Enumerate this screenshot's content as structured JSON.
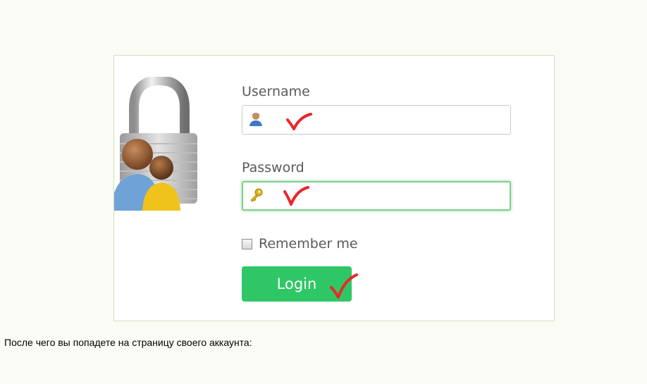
{
  "form": {
    "username_label": "Username",
    "password_label": "Password",
    "remember_label": "Remember me",
    "login_label": "Login",
    "remember_checked": false
  },
  "caption": "После чего вы попадете на страницу своего аккаунта:",
  "icons": {
    "illustration": "padlock-users-icon",
    "username_field": "user-icon",
    "password_field": "key-icon",
    "annotation": "red-checkmark-icon"
  },
  "colors": {
    "page_background": "#fbfbf5",
    "frame_border": "#d6ddb5",
    "login_button": "#2fc765",
    "password_focus_border": "#7fcf8d",
    "annotation_mark": "#e8282b"
  }
}
